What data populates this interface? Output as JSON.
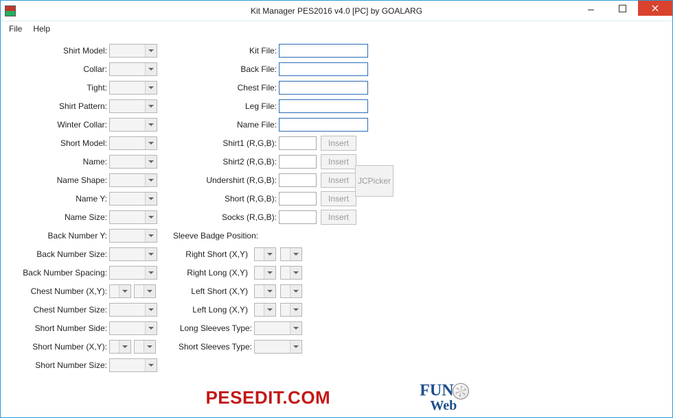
{
  "title": "Kit Manager PES2016 v4.0 [PC] by GOALARG",
  "menu": {
    "file": "File",
    "help": "Help"
  },
  "labels": {
    "shirtModel": "Shirt Model:",
    "collar": "Collar:",
    "tight": "Tight:",
    "shirtPattern": "Shirt Pattern:",
    "winterCollar": "Winter Collar:",
    "shortModel": "Short Model:",
    "name": "Name:",
    "nameShape": "Name Shape:",
    "nameY": "Name Y:",
    "nameSize": "Name Size:",
    "backNumberY": "Back Number Y:",
    "backNumberSize": "Back Number Size:",
    "backNumberSpacing": "Back Number Spacing:",
    "chestNumberXY": "Chest Number (X,Y):",
    "chestNumberSize": "Chest Number Size:",
    "shortNumberSide": "Short Number Side:",
    "shortNumberXY": "Short Number (X,Y):",
    "shortNumberSize": "Short Number Size:",
    "kitFile": "Kit File:",
    "backFile": "Back File:",
    "chestFile": "Chest File:",
    "legFile": "Leg File:",
    "nameFile": "Name File:",
    "shirt1RGB": "Shirt1 (R,G,B):",
    "shirt2RGB": "Shirt2 (R,G,B):",
    "undershirtRGB": "Undershirt (R,G,B):",
    "shortRGB": "Short (R,G,B):",
    "socksRGB": "Socks (R,G,B):",
    "sleeveBadge": "Sleeve Badge Position:",
    "rightShort": "Right Short (X,Y)",
    "rightLong": "Right Long (X,Y)",
    "leftShort": "Left Short (X,Y)",
    "leftLong": "Left Long (X,Y)",
    "longSleevesType": "Long Sleeves Type:",
    "shortSleevesType": "Short Sleeves Type:"
  },
  "buttons": {
    "insert": "Insert",
    "jcpicker": "JCPicker"
  },
  "logos": {
    "pesedit": "PESEDIT.COM",
    "fun": "FUN",
    "web": "Web"
  }
}
